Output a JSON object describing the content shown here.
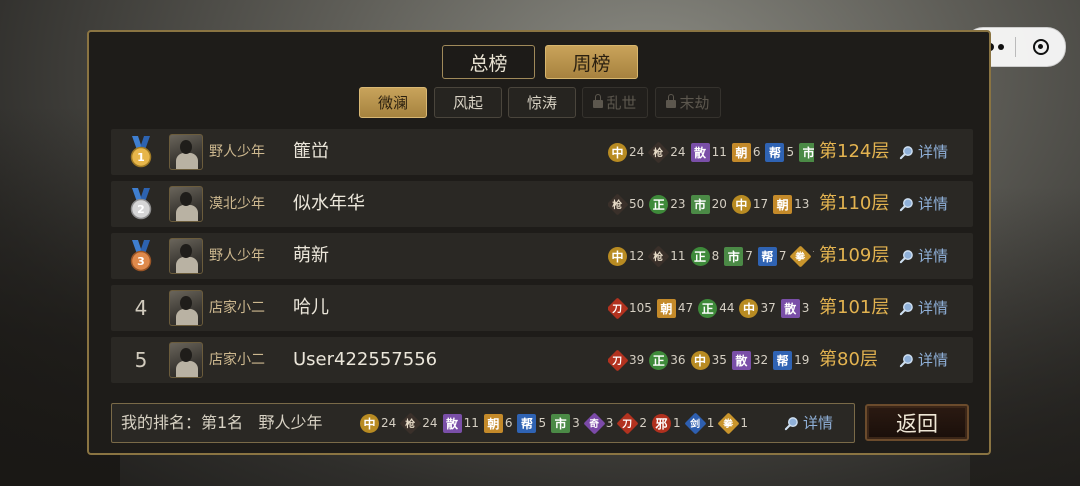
{
  "capsule": {
    "more_icon": "more-dots-icon",
    "close_icon": "target-circle-icon"
  },
  "tabs": [
    {
      "label": "总榜",
      "active": false
    },
    {
      "label": "周榜",
      "active": true
    }
  ],
  "sub_tabs": [
    {
      "label": "微澜",
      "state": "active"
    },
    {
      "label": "风起",
      "state": "normal"
    },
    {
      "label": "惊涛",
      "state": "normal"
    },
    {
      "label": "乱世",
      "state": "locked"
    },
    {
      "label": "末劫",
      "state": "locked"
    }
  ],
  "colors": {
    "gold": "#e3b350",
    "link": "#8fb0d8",
    "border": "#8a7442"
  },
  "rows": [
    {
      "rank": "1",
      "medal": "gold",
      "title": "野人少年",
      "name": "  篚峃",
      "floor": "第124层",
      "detail": "详情",
      "skills": [
        [
          "中",
          "24"
        ],
        [
          "枪",
          "24"
        ],
        [
          "散",
          "11"
        ],
        [
          "朝",
          "6"
        ],
        [
          "帮",
          "5"
        ],
        [
          "市",
          ""
        ]
      ]
    },
    {
      "rank": "2",
      "medal": "silver",
      "title": "漠北少年",
      "name": "似水年华",
      "floor": "第110层",
      "detail": "详情",
      "skills": [
        [
          "枪",
          "50"
        ],
        [
          "正",
          "23"
        ],
        [
          "市",
          "20"
        ],
        [
          "中",
          "17"
        ],
        [
          "朝",
          "13"
        ]
      ]
    },
    {
      "rank": "3",
      "medal": "bronze",
      "title": "野人少年",
      "name": "萌新",
      "floor": "第109层",
      "detail": "详情",
      "skills": [
        [
          "中",
          "12"
        ],
        [
          "枪",
          "11"
        ],
        [
          "正",
          "8"
        ],
        [
          "市",
          "7"
        ],
        [
          "帮",
          "7"
        ],
        [
          "拳",
          "7"
        ]
      ]
    },
    {
      "rank": "4",
      "medal": "",
      "title": "店家小二",
      "name": "哈儿",
      "floor": "第101层",
      "detail": "详情",
      "skills": [
        [
          "刀",
          "105"
        ],
        [
          "朝",
          "47"
        ],
        [
          "正",
          "44"
        ],
        [
          "中",
          "37"
        ],
        [
          "散",
          "3"
        ]
      ]
    },
    {
      "rank": "5",
      "medal": "",
      "title": "店家小二",
      "name": "User422557556",
      "floor": "第80层",
      "detail": "详情",
      "skills": [
        [
          "刀",
          "39"
        ],
        [
          "正",
          "36"
        ],
        [
          "中",
          "35"
        ],
        [
          "散",
          "32"
        ],
        [
          "帮",
          "19"
        ]
      ]
    }
  ],
  "my_rank": {
    "label": "我的排名：第1名",
    "title": "野人少年",
    "detail": "详情",
    "skills": [
      [
        "中",
        "24"
      ],
      [
        "枪",
        "24"
      ],
      [
        "散",
        "11"
      ],
      [
        "朝",
        "6"
      ],
      [
        "帮",
        "5"
      ],
      [
        "市",
        "3"
      ],
      [
        "奇",
        "3"
      ],
      [
        "刀",
        "2"
      ],
      [
        "邪",
        "1"
      ],
      [
        "剑",
        "1"
      ],
      [
        "拳",
        "1"
      ]
    ]
  },
  "back_label": "返回"
}
